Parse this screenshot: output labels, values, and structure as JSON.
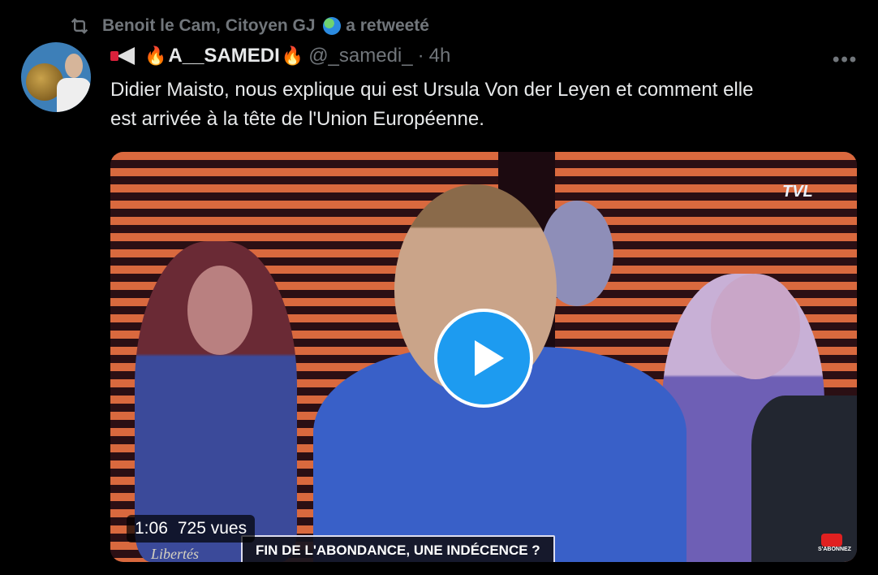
{
  "retweet": {
    "icon": "retweet-icon",
    "retweeter": "Benoit le Cam, Citoyen GJ",
    "label": "a retweeté"
  },
  "tweet": {
    "display_name": "A__SAMEDI",
    "handle": "@_samedi_",
    "separator": "·",
    "time": "4h",
    "text_line1": "Didier Maisto, nous explique qui est Ursula Von der Leyen et comment elle",
    "text_line2": "est arrivée à la tête de l'Union Européenne.",
    "more": "•••"
  },
  "video": {
    "duration": "1:06",
    "views": "725 vues",
    "chyron": "FIN DE L'ABONDANCE, UNE INDÉCENCE ?",
    "channel_logo": "TVL",
    "show_logo": "Libertés",
    "subscribe": "S'ABONNEZ"
  },
  "colors": {
    "background": "#000000",
    "accent": "#1d9bf0",
    "muted_text": "#71767b"
  }
}
